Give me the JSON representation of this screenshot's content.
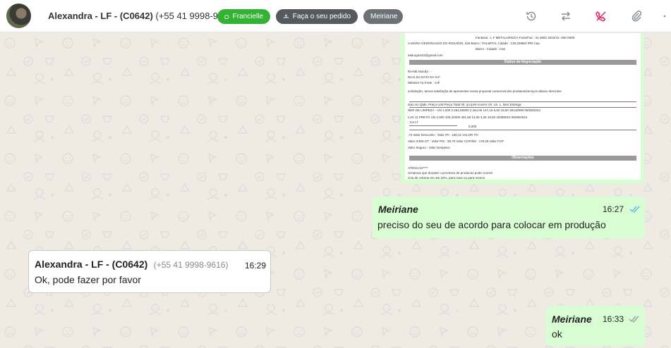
{
  "header": {
    "contact_name": "Alexandra - LF - (C0642)",
    "contact_phone": "(+55 41 9998-9616)",
    "tags": [
      {
        "label": "Francielle",
        "color": "#34b233",
        "icon": "whatsapp-icon"
      },
      {
        "label": "Faça o seu pedido",
        "color": "#545a5f",
        "icon": "hierarchy-icon"
      },
      {
        "label": "Meiriane",
        "color": "#6b7175"
      }
    ],
    "icons": [
      "history-icon",
      "transfer-icon",
      "end-call-icon",
      "attachment-icon",
      "more-icon"
    ]
  },
  "document": {
    "header_rows": [
      "Fantasia  :  L F METALURGICA          Fone/Fax  :  41-3062 2022/41- 000 0000",
      "A MARIA GERONASSO DO ROSÁRIO, 226     Bairro  :  PALMITAL          Cidade  :  COLOMBO    /PR        Cep",
      "Bairro  :                              Cidade  :                             Cep",
      "etalurgica23@gmail.com"
    ],
    "negotiation_title": "Dados da Negociação",
    "negotiation_rows": [
      "RIANE                                                    Moeda  :  -",
      "DIAS DA DATA DA N.F.",
      "08/2024                                                 Tp.Frete  :  CIF"
    ],
    "intro": "solicitação, temos satisfação de apresentar nossa proposta comercial dos produtos/serviços abaixo descritos",
    "table_header": "duto          Un   Qtde.   Preço Unit   Preço Total   Vlr. Ipi   Ipi%   Icms%   Vlr. Un. L.   Item   Entrega",
    "table_rows": [
      "NER DE LIMPEZA -   UN   1,000   2.264,06000   2.264,06   147,16   6,50   19,50   38140090   05/08/2024",
      "LUX 11 PRETO   UN   4,000   100,42000   401,68   13,05   3,25   19,50   32089010   05/08/2024",
      "; 3,6 LT"
    ],
    "subtotal": "5,000",
    "totals_rows": [
      ",74          Valor Desconto  :              Valor IPI     :   160,21                                VALOR TO",
      "              Valor ICMS-ST   :              Valor PIS     :   38,70      Valor COFINS  :   178,28    Valor FCP",
      "              Valor Seguro    :              Valor Despesa :"
    ],
    "observations_title": "Observações",
    "observations_rows": [
      "ATENCAO****",
      "ormamos que durante o processo de producao pode ocorrer",
      "ncia de volume em ate 10%, para mais ou para menos"
    ]
  },
  "messages": [
    {
      "direction": "out",
      "sender": "Meiriane",
      "time": "16:27",
      "text": "preciso do seu de acordo para colocar em produção",
      "status": "read"
    },
    {
      "direction": "in",
      "sender": "Alexandra - LF - (C0642)",
      "phone": "(+55 41 9998-9616)",
      "time": "16:29",
      "text": "Ok, pode fazer por favor"
    },
    {
      "direction": "out",
      "sender": "Meiriane",
      "time": "16:33",
      "text": "ok",
      "status": "delivered"
    }
  ],
  "colors": {
    "bubble_out": "#d9fdd3",
    "bubble_in": "#ffffff",
    "read_tick": "#53bdeb",
    "end_call": "#e0245e",
    "chat_bg": "#efeae2"
  }
}
